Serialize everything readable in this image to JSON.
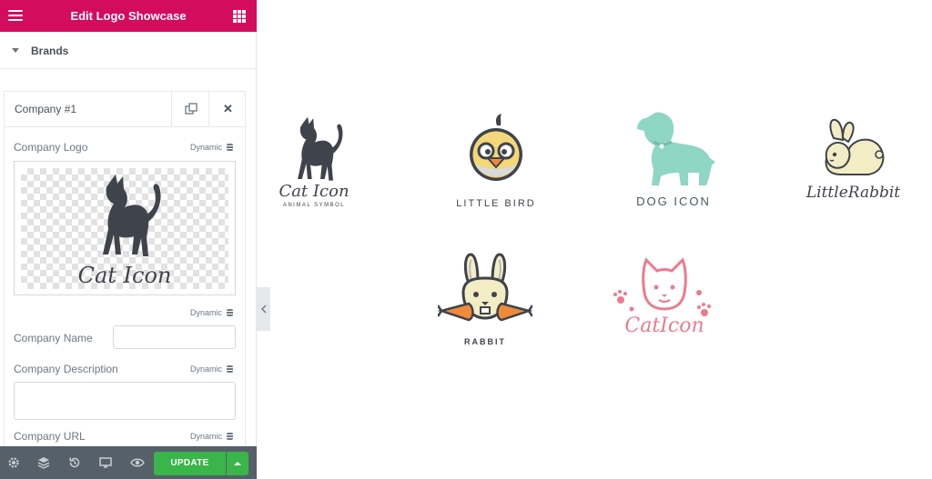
{
  "header": {
    "title": "Edit Logo Showcase"
  },
  "section": {
    "label": "Brands"
  },
  "repeater": {
    "item_title": "Company #1",
    "logo_label": "Company Logo",
    "dynamic_label": "Dynamic",
    "preview_logo_text": "Cat Icon",
    "name_label": "Company Name",
    "name_value": "",
    "description_label": "Company Description",
    "description_value": "",
    "url_label": "Company URL"
  },
  "footer": {
    "update_label": "UPDATE"
  },
  "logos": [
    {
      "name": "Cat Icon",
      "tagline": "ANIMAL SYMBOL",
      "color": "#3f434b"
    },
    {
      "name": "LITTLE BIRD",
      "color": "#f4d77a"
    },
    {
      "name": "DOG ICON",
      "color": "#8fd6c4"
    },
    {
      "name": "LittleRabbit",
      "color": "#f3edc6"
    },
    {
      "name": "RABBIT",
      "color": "#ef8a3a"
    },
    {
      "name": "CatIcon",
      "color": "#ee7a8e"
    }
  ],
  "colors": {
    "brand": "#d30c5c",
    "update": "#39b54a",
    "footer": "#556068"
  }
}
